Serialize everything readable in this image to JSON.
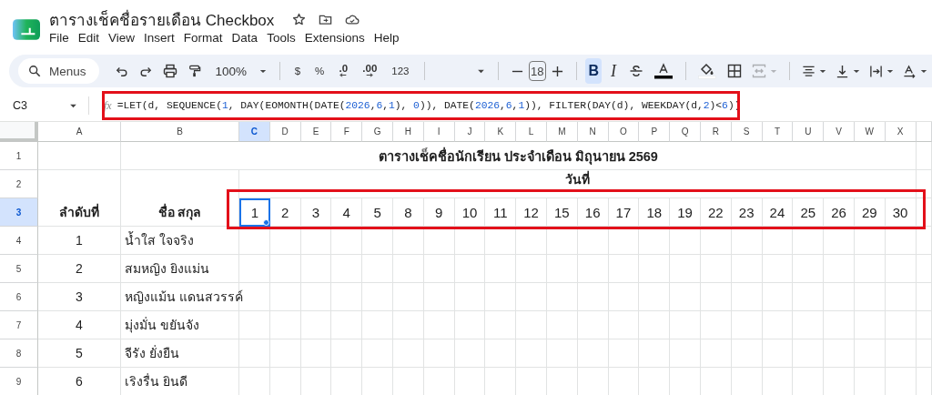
{
  "app": {
    "title": "ตารางเช็คชื่อรายเดือน Checkbox"
  },
  "menu": [
    "File",
    "Edit",
    "View",
    "Insert",
    "Format",
    "Data",
    "Tools",
    "Extensions",
    "Help"
  ],
  "toolbar": [
    {
      "kind": "search",
      "label": "Menus"
    },
    {
      "kind": "undo"
    },
    {
      "kind": "redo"
    },
    {
      "kind": "print"
    },
    {
      "kind": "paint-format"
    },
    {
      "kind": "zoom",
      "label": "100%"
    },
    {
      "kind": "separator"
    },
    {
      "kind": "text",
      "label": "$"
    },
    {
      "kind": "text",
      "label": "%"
    },
    {
      "kind": "decimal-less",
      "label": ".0"
    },
    {
      "kind": "decimal-more",
      "label": ".00"
    },
    {
      "kind": "text",
      "label": "123"
    },
    {
      "kind": "separator"
    },
    {
      "kind": "font"
    },
    {
      "kind": "separator"
    },
    {
      "kind": "minus"
    },
    {
      "kind": "size",
      "label": "18"
    },
    {
      "kind": "plus"
    },
    {
      "kind": "separator"
    },
    {
      "kind": "bold",
      "label": "B",
      "on": true
    },
    {
      "kind": "italic",
      "label": "I",
      "on": false
    },
    {
      "kind": "strike",
      "on": false
    },
    {
      "kind": "text-color"
    },
    {
      "kind": "separator"
    },
    {
      "kind": "fill"
    },
    {
      "kind": "borders"
    },
    {
      "kind": "merge",
      "disabled": true
    },
    {
      "kind": "separator"
    },
    {
      "kind": "align"
    },
    {
      "kind": "valign"
    },
    {
      "kind": "wrap"
    },
    {
      "kind": "rotate"
    }
  ],
  "formula_bar": {
    "name_box": "C3",
    "fx": "fx",
    "formula": [
      {
        "kind": "text",
        "text": "=LET(d, SEQUENCE("
      },
      {
        "kind": "number",
        "text": "1"
      },
      {
        "kind": "text",
        "text": ", DAY(EOMONTH(DATE("
      },
      {
        "kind": "number",
        "text": "2026"
      },
      {
        "kind": "text",
        "text": ","
      },
      {
        "kind": "number",
        "text": "6"
      },
      {
        "kind": "text",
        "text": ","
      },
      {
        "kind": "number",
        "text": "1"
      },
      {
        "kind": "text",
        "text": "), "
      },
      {
        "kind": "number",
        "text": "0"
      },
      {
        "kind": "text",
        "text": ")), DATE("
      },
      {
        "kind": "number",
        "text": "2026"
      },
      {
        "kind": "text",
        "text": ","
      },
      {
        "kind": "number",
        "text": "6"
      },
      {
        "kind": "text",
        "text": ","
      },
      {
        "kind": "number",
        "text": "1"
      },
      {
        "kind": "text",
        "text": ")), FILTER(DAY(d), WEEKDAY(d,"
      },
      {
        "kind": "number",
        "text": "2"
      },
      {
        "kind": "text",
        "text": ")<"
      },
      {
        "kind": "number",
        "text": "6"
      },
      {
        "kind": "text",
        "text": "))"
      }
    ]
  },
  "sheet": {
    "columns": [
      {
        "label": "A",
        "selected": false
      },
      {
        "label": "B",
        "selected": false
      },
      {
        "label": "C",
        "selected": true
      },
      {
        "label": "D",
        "selected": false
      },
      {
        "label": "E",
        "selected": false
      },
      {
        "label": "F",
        "selected": false
      },
      {
        "label": "G",
        "selected": false
      },
      {
        "label": "H",
        "selected": false
      },
      {
        "label": "I",
        "selected": false
      },
      {
        "label": "J",
        "selected": false
      },
      {
        "label": "K",
        "selected": false
      },
      {
        "label": "L",
        "selected": false
      },
      {
        "label": "M",
        "selected": false
      },
      {
        "label": "N",
        "selected": false
      },
      {
        "label": "O",
        "selected": false
      },
      {
        "label": "P",
        "selected": false
      },
      {
        "label": "Q",
        "selected": false
      },
      {
        "label": "R",
        "selected": false
      },
      {
        "label": "S",
        "selected": false
      },
      {
        "label": "T",
        "selected": false
      },
      {
        "label": "U",
        "selected": false
      },
      {
        "label": "V",
        "selected": false
      },
      {
        "label": "W",
        "selected": false
      },
      {
        "label": "X",
        "selected": false
      }
    ],
    "rows": [
      {
        "label": "1",
        "selected": false
      },
      {
        "label": "2",
        "selected": false
      },
      {
        "label": "3",
        "selected": true
      },
      {
        "label": "4",
        "selected": false
      },
      {
        "label": "5",
        "selected": false
      },
      {
        "label": "6",
        "selected": false
      },
      {
        "label": "7",
        "selected": false
      },
      {
        "label": "8",
        "selected": false
      },
      {
        "label": "9",
        "selected": false
      }
    ],
    "title": "ตารางเช็คชื่อนักเรียน ประจำเดือน มิถุนายน 2569",
    "date_heading": "วันที่",
    "number_heading": "ลำดับที่",
    "name_heading": "ชื่อ สกุล",
    "dates": [
      {
        "text": "1",
        "selected": true
      },
      {
        "text": "2",
        "selected": false
      },
      {
        "text": "3",
        "selected": false
      },
      {
        "text": "4",
        "selected": false
      },
      {
        "text": "5",
        "selected": false
      },
      {
        "text": "8",
        "selected": false
      },
      {
        "text": "9",
        "selected": false
      },
      {
        "text": "10",
        "selected": false
      },
      {
        "text": "11",
        "selected": false
      },
      {
        "text": "12",
        "selected": false
      },
      {
        "text": "15",
        "selected": false
      },
      {
        "text": "16",
        "selected": false
      },
      {
        "text": "17",
        "selected": false
      },
      {
        "text": "18",
        "selected": false
      },
      {
        "text": "19",
        "selected": false
      },
      {
        "text": "22",
        "selected": false
      },
      {
        "text": "23",
        "selected": false
      },
      {
        "text": "24",
        "selected": false
      },
      {
        "text": "25",
        "selected": false
      },
      {
        "text": "26",
        "selected": false
      },
      {
        "text": "29",
        "selected": false
      },
      {
        "text": "30",
        "selected": false
      }
    ],
    "students": [
      {
        "no": "1",
        "name": "น้ำใส ใจจริง"
      },
      {
        "no": "2",
        "name": "สมหญิง ยิงแม่น"
      },
      {
        "no": "3",
        "name": "หญิงแม้น แดนสวรรค์"
      },
      {
        "no": "4",
        "name": "มุ่งมั่น ขยันจัง"
      },
      {
        "no": "5",
        "name": "จีรัง ยั่งยืน"
      },
      {
        "no": "6",
        "name": "เริงรื่น ยินดี"
      }
    ]
  }
}
